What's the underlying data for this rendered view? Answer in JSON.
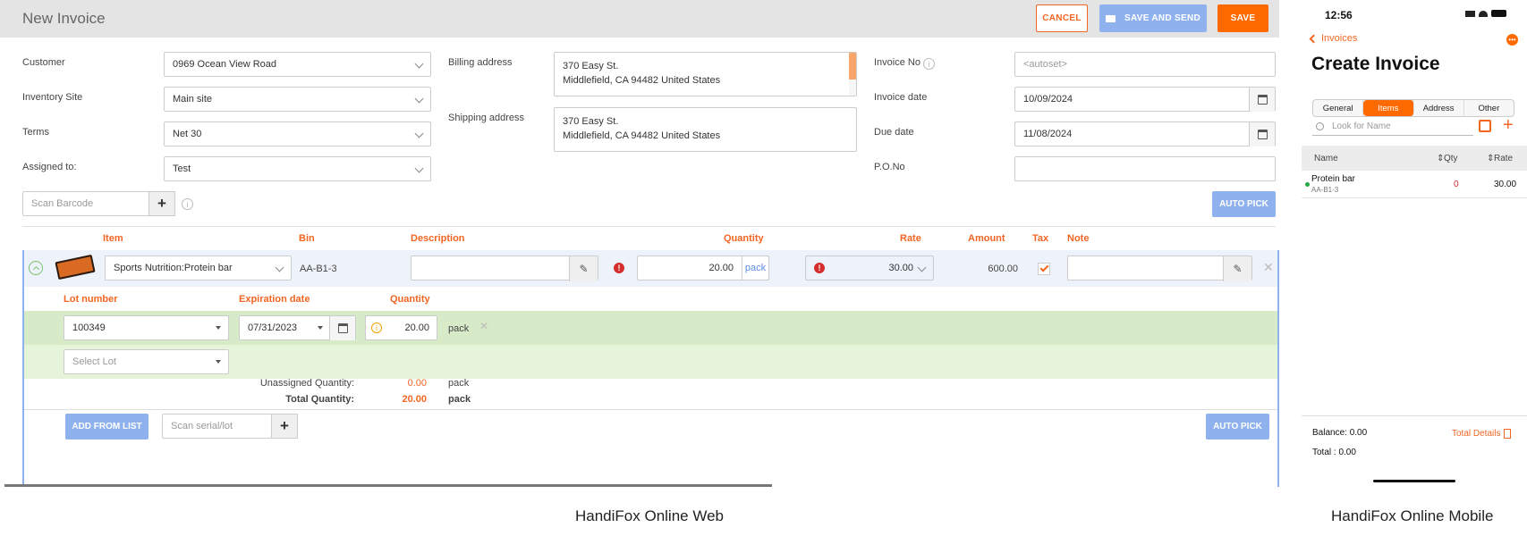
{
  "web": {
    "title": "New Invoice",
    "buttons": {
      "cancel": "CANCEL",
      "save_send": "SAVE AND SEND",
      "save": "SAVE",
      "auto_pick": "AUTO PICK",
      "add_from_list": "ADD FROM LIST"
    },
    "form": {
      "customer_label": "Customer",
      "customer_value": "0969 Ocean View Road",
      "inventory_site_label": "Inventory Site",
      "inventory_site_value": "Main site",
      "terms_label": "Terms",
      "terms_value": "Net 30",
      "assigned_label": "Assigned to:",
      "assigned_value": "Test",
      "billing_label": "Billing address",
      "billing_line1": "370 Easy St.",
      "billing_line2": "Middlefield, CA 94482 United States",
      "shipping_label": "Shipping address",
      "shipping_line1": "370 Easy St.",
      "shipping_line2": "Middlefield, CA 94482 United States",
      "invoice_no_label": "Invoice No",
      "invoice_no_placeholder": "<autoset>",
      "invoice_date_label": "Invoice date",
      "invoice_date_value": "10/09/2024",
      "due_date_label": "Due date",
      "due_date_value": "11/08/2024",
      "po_label": "P.O.No",
      "scan_barcode_placeholder": "Scan Barcode"
    },
    "columns": {
      "item": "Item",
      "bin": "Bin",
      "description": "Description",
      "quantity": "Quantity",
      "rate": "Rate",
      "amount": "Amount",
      "tax": "Tax",
      "note": "Note"
    },
    "line": {
      "item": "Sports Nutrition:Protein bar",
      "bin": "AA-B1-3",
      "quantity": "20.00",
      "unit": "pack",
      "rate": "30.00",
      "amount": "600.00",
      "tax_checked": true
    },
    "lot_columns": {
      "lot": "Lot number",
      "expiration": "Expiration date",
      "quantity": "Quantity"
    },
    "lot_row": {
      "lot": "100349",
      "expiration": "07/31/2023",
      "quantity": "20.00",
      "unit": "pack"
    },
    "select_lot_placeholder": "Select Lot",
    "unassigned_label": "Unassigned Quantity:",
    "unassigned_value": "0.00",
    "unassigned_unit": "pack",
    "total_label": "Total Quantity:",
    "total_value": "20.00",
    "total_unit": "pack",
    "scan_serial_placeholder": "Scan serial/lot",
    "accent_color": "#f26522",
    "caption": "HandiFox Online Web"
  },
  "mobile": {
    "time": "12:56",
    "back_label": "Invoices",
    "title": "Create Invoice",
    "tabs": [
      "General",
      "Items",
      "Address",
      "Other"
    ],
    "active_tab": "Items",
    "search_placeholder": "Look for Name",
    "columns": {
      "name": "Name",
      "qty": "Qty",
      "rate": "Rate"
    },
    "row": {
      "name": "Protein bar",
      "bin": "AA-B1-3",
      "qty": "0",
      "rate": "30.00"
    },
    "balance": "Balance: 0.00",
    "total": "Total : 0.00",
    "total_details": "Total Details",
    "caption": "HandiFox Online Mobile"
  }
}
